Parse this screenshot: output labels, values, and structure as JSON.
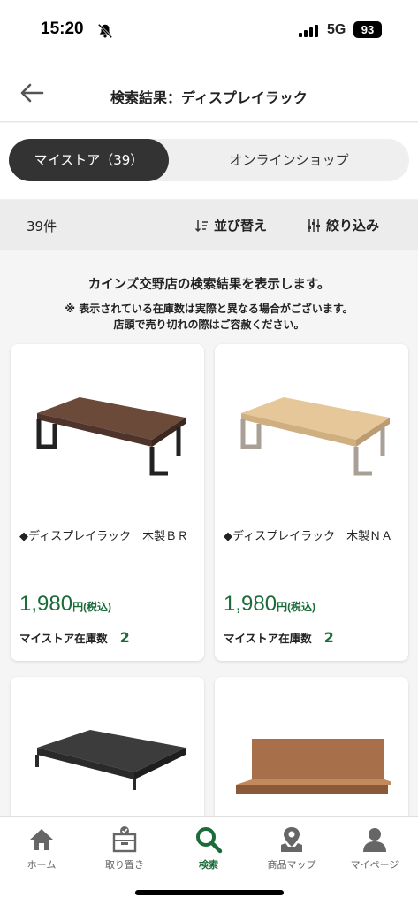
{
  "status": {
    "time": "15:20",
    "network": "5G",
    "battery": "93"
  },
  "header": {
    "title": "検索結果：ディスプレイラック"
  },
  "segment": {
    "my_store": "マイストア（39）",
    "online": "オンラインショップ"
  },
  "filter": {
    "count": "39件",
    "sort": "並び替え",
    "refine": "絞り込み"
  },
  "notice": {
    "main": "カインズ交野店の検索結果を表示します。",
    "sub1": "※ 表示されている在庫数は実際と異なる場合がございます。",
    "sub2": "店頭で売り切れの際はご容赦ください。"
  },
  "products": [
    {
      "name": "◆ディスプレイラック　木製ＢＲ",
      "price": "1,980",
      "unit": "円(税込)",
      "stock_label": "マイストア在庫数",
      "stock": "2"
    },
    {
      "name": "◆ディスプレイラック　木製ＮＡ",
      "price": "1,980",
      "unit": "円(税込)",
      "stock_label": "マイストア在庫数",
      "stock": "2"
    },
    {
      "name": "",
      "price": "",
      "unit": "",
      "stock_label": "",
      "stock": ""
    },
    {
      "name": "",
      "price": "",
      "unit": "",
      "stock_label": "",
      "stock": ""
    }
  ],
  "tabs": [
    {
      "label": "ホーム",
      "icon": "home-icon"
    },
    {
      "label": "取り置き",
      "icon": "reserve-icon"
    },
    {
      "label": "検索",
      "icon": "search-icon"
    },
    {
      "label": "商品マップ",
      "icon": "map-icon"
    },
    {
      "label": "マイページ",
      "icon": "user-icon"
    }
  ],
  "colors": {
    "accent": "#1b6b3a",
    "segment_active": "#333333"
  }
}
